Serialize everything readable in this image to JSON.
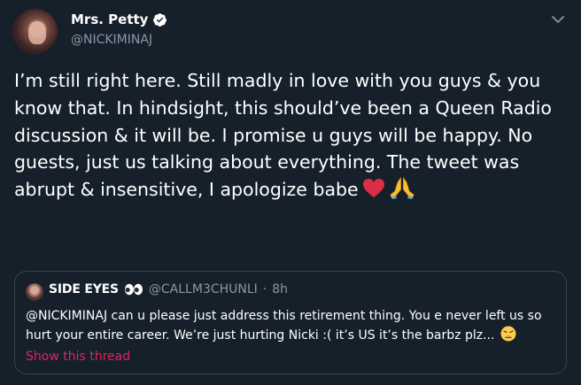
{
  "tweet": {
    "author": {
      "display_name": "Mrs. Petty",
      "handle": "@NICKIMINAJ",
      "verified": true
    },
    "more_options_icon": "chevron-down-icon",
    "text": "I’m still right here. Still madly in love with you guys & you know that. In hindsight, this should’ve been a Queen Radio discussion & it will be. I promise u guys will be happy. No guests, just us talking about everything. The tweet was abrupt & insensitive, I apologize babe",
    "emojis": [
      "heart-icon",
      "praying-hands-icon"
    ]
  },
  "quoted_tweet": {
    "display_name": "SIDE EYES",
    "name_emoji": "eyes-icon",
    "handle": "@CALLM3CHUNLI",
    "separator": "·",
    "time": "8h",
    "text": "@NICKIMINAJ can u please just address this retirement thing. You e never left us so hurt your entire career. We’re just hurting Nicki :( it’s US it’s the barbz plz...",
    "trailing_emoji": "weary-face-icon",
    "show_thread": "Show this thread"
  },
  "colors": {
    "background": "#15202b",
    "secondary_text": "#8899a6",
    "border": "#38444d",
    "link": "#e0245e",
    "verified": "#ffffff"
  }
}
